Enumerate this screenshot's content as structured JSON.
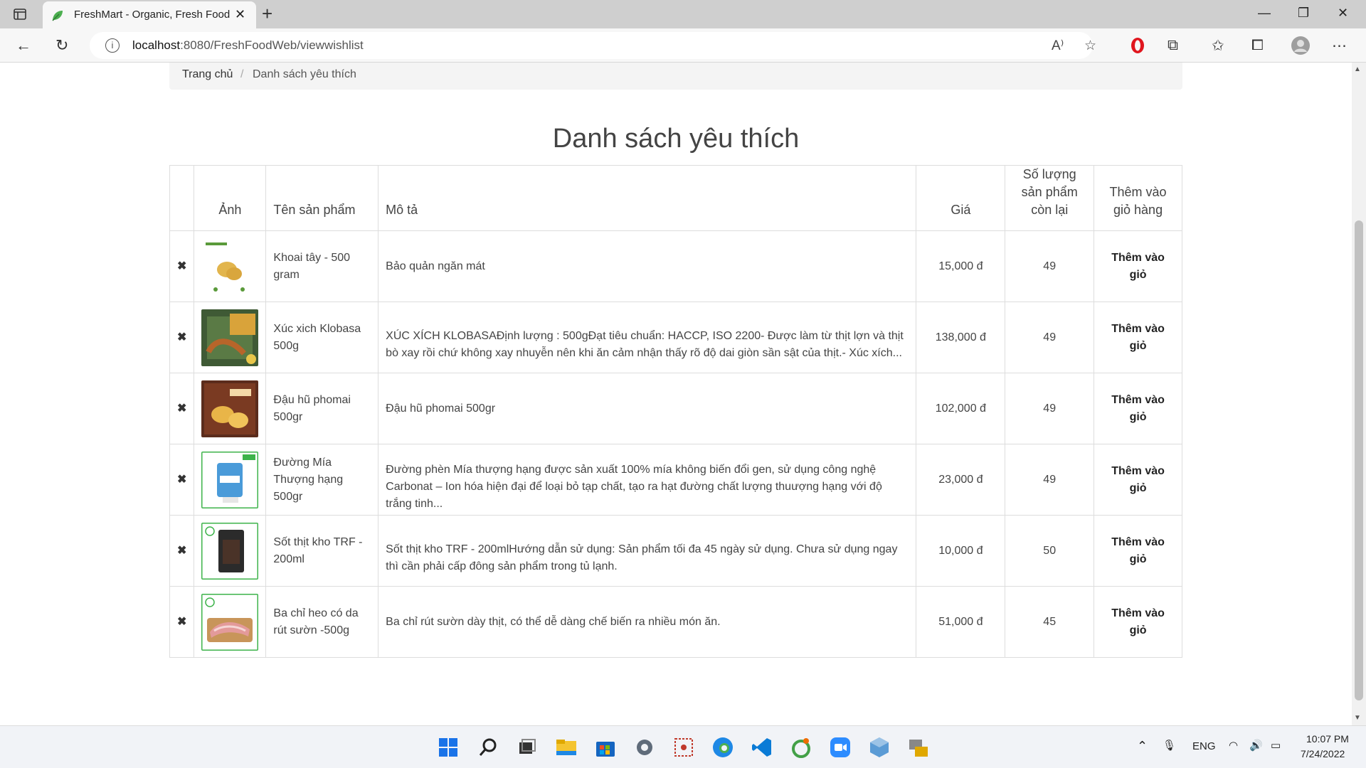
{
  "browser": {
    "tab_title": "FreshMart - Organic, Fresh Food",
    "new_tab": "+",
    "url_host": "localhost",
    "url_rest": ":8080/FreshFoodWeb/viewwishlist",
    "controls": {
      "minimize": "—",
      "maximize": "❐",
      "close": "✕"
    }
  },
  "breadcrumb": {
    "home": "Trang chủ",
    "separator": "/",
    "current": "Danh sách yêu thích"
  },
  "page": {
    "title": "Danh sách yêu thích"
  },
  "table": {
    "headers": {
      "image": "Ảnh",
      "name": "Tên sản phẩm",
      "description": "Mô tả",
      "price": "Giá",
      "quantity": "Số lượng sản phẩm còn lại",
      "cart": "Thêm vào giỏ hàng"
    },
    "rows": [
      {
        "delete": "✖",
        "name": "Khoai tây - 500 gram",
        "description": "Bảo quản ngăn mát",
        "price": "15,000 đ",
        "quantity": "49",
        "action": "Thêm vào giỏ"
      },
      {
        "delete": "✖",
        "name": "Xúc xich Klobasa 500g",
        "description": "XÚC XÍCH KLOBASAĐịnh lượng : 500gĐạt tiêu chuẩn: HACCP, ISO 2200- Được làm từ thịt lợn và thịt bò xay rồi chứ không xay nhuyễn nên khi ăn cảm nhận thấy rõ độ dai giòn sần sật của thịt.- Xúc xích...",
        "price": "138,000 đ",
        "quantity": "49",
        "action": "Thêm vào giỏ"
      },
      {
        "delete": "✖",
        "name": "Đậu hũ phomai 500gr",
        "description": "Đậu hũ phomai 500gr",
        "price": "102,000 đ",
        "quantity": "49",
        "action": "Thêm vào giỏ"
      },
      {
        "delete": "✖",
        "name": "Đường Mía Thượng hạng 500gr",
        "description": "Đường phèn Mía thượng hạng được sản xuất 100% mía không biến đổi gen, sử dụng công nghệ Carbonat – Ion hóa hiện đại để loại bỏ tạp chất, tạo ra hạt đường chất lượng thuượng hạng với độ trắng tinh...",
        "price": "23,000 đ",
        "quantity": "49",
        "action": "Thêm vào giỏ"
      },
      {
        "delete": "✖",
        "name": "Sốt thịt kho TRF - 200ml",
        "description": "Sốt thịt kho TRF - 200mlHướng dẫn sử dụng: Sản phẩm tối đa 45 ngày sử dụng. Chưa sử dụng ngay thì cần phải cấp đông sản phẩm trong tủ lạnh.",
        "price": "10,000 đ",
        "quantity": "50",
        "action": "Thêm vào giỏ"
      },
      {
        "delete": "✖",
        "name": "Ba chỉ heo có da rút sườn -500g",
        "description": "Ba chỉ rút sườn dày thịt, có thể dễ dàng chế biến ra nhiều món ăn.",
        "price": "51,000 đ",
        "quantity": "45",
        "action": "Thêm vào giỏ"
      }
    ]
  },
  "taskbar": {
    "language": "ENG",
    "time": "10:07 PM",
    "date": "7/24/2022"
  }
}
